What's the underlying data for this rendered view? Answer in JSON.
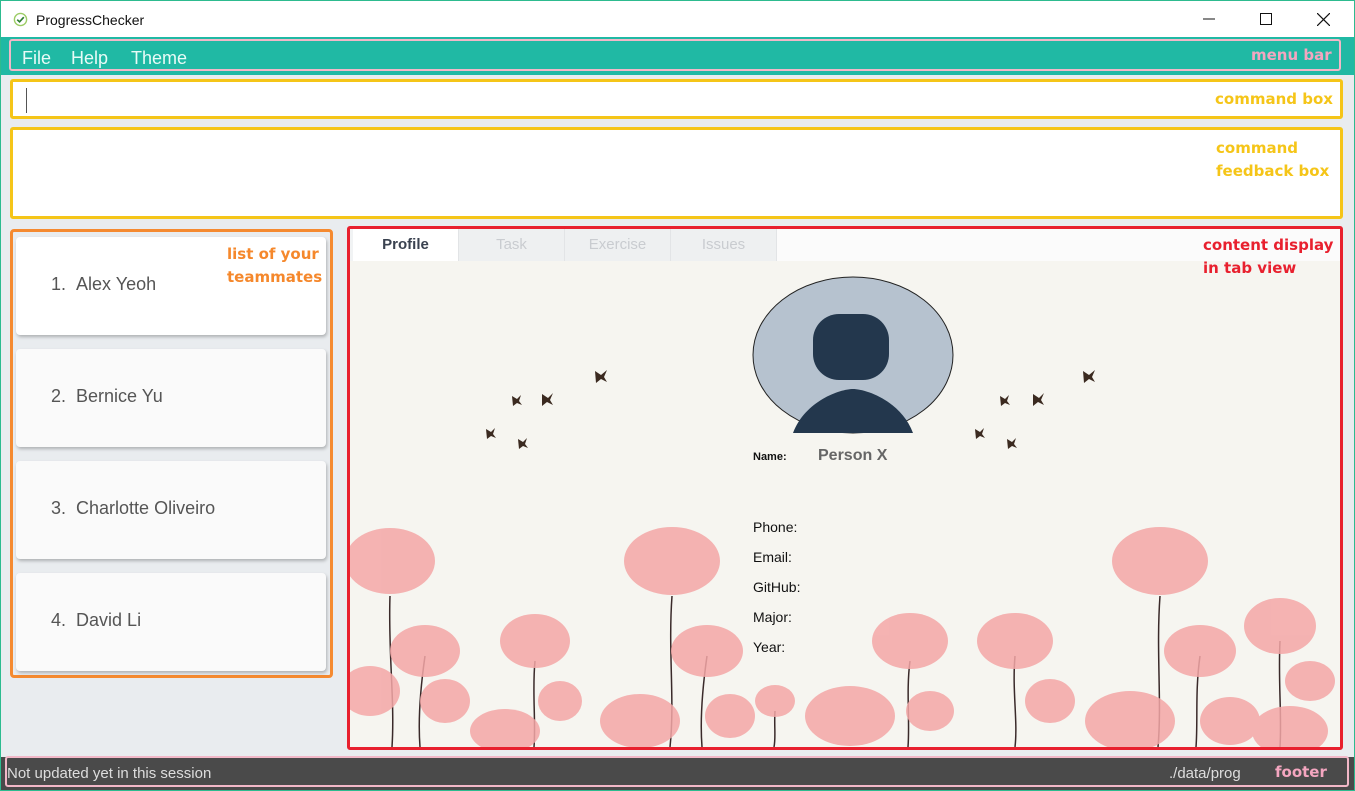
{
  "window": {
    "title": "ProgressChecker"
  },
  "menu": {
    "items": [
      "File",
      "Help",
      "Theme"
    ]
  },
  "command_box": {
    "value": "",
    "placeholder": ""
  },
  "annotations": {
    "menu_bar": "menu bar",
    "command_box": "command box",
    "feedback_line1": "command",
    "feedback_line2": "feedback box",
    "team_line1": "list of your",
    "team_line2": "teammates",
    "content_line1": "content display",
    "content_line2": "in tab view",
    "footer": "footer"
  },
  "team": [
    {
      "index": "1.",
      "name": "Alex Yeoh"
    },
    {
      "index": "2.",
      "name": "Bernice Yu"
    },
    {
      "index": "3.",
      "name": "Charlotte Oliveiro"
    },
    {
      "index": "4.",
      "name": "David Li"
    }
  ],
  "tabs": [
    {
      "label": "Profile",
      "active": true
    },
    {
      "label": "Task",
      "active": false
    },
    {
      "label": "Exercise",
      "active": false
    },
    {
      "label": "Issues",
      "active": false
    }
  ],
  "profile": {
    "name_label": "Name:",
    "name_value": "Person X",
    "fields": [
      "Phone:",
      "Email:",
      "GitHub:",
      "Major:",
      "Year:"
    ]
  },
  "footer": {
    "status": "Not updated yet in this session",
    "path": "./data/prog"
  },
  "colors": {
    "menu_bar": "#20b9a4",
    "command_border": "#f5c518",
    "team_border": "#f58a30",
    "content_border": "#e8202e",
    "footer": "#4a4a4a"
  },
  "icons": [
    "app-check-icon",
    "minimize-icon",
    "maximize-icon",
    "close-icon",
    "avatar-icon"
  ]
}
